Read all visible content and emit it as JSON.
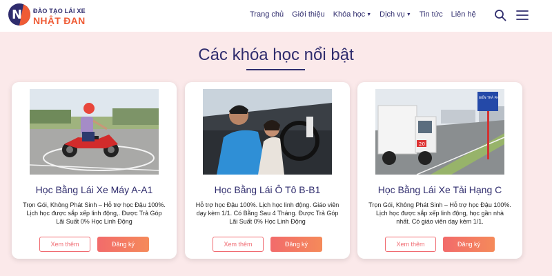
{
  "logo": {
    "top_text": "ĐÀO TẠO LÁI XE",
    "bottom_text": "NHẬT ĐAN",
    "mark": "N"
  },
  "nav": [
    {
      "label": "Trang chủ",
      "has_dropdown": false
    },
    {
      "label": "Giới thiệu",
      "has_dropdown": false
    },
    {
      "label": "Khóa học",
      "has_dropdown": true
    },
    {
      "label": "Dịch vụ",
      "has_dropdown": true
    },
    {
      "label": "Tin tức",
      "has_dropdown": false
    },
    {
      "label": "Liên hệ",
      "has_dropdown": false
    }
  ],
  "icons": {
    "search": "search-icon",
    "menu": "hamburger-menu-icon"
  },
  "section": {
    "title": "Các khóa học nổi bật"
  },
  "colors": {
    "primary": "#2f2c6d",
    "accent": "#ef5b35",
    "button": "#f26b6b",
    "background": "#fbe9ea"
  },
  "cards": [
    {
      "title": "Học Bằng Lái Xe Máy A-A1",
      "desc_lines": [
        "Trọn Gói, Không Phát Sinh – Hỗ trợ học Đậu 100%.",
        "Lịch học được sắp xếp linh động,. Được Trả Góp",
        "Lãi Suất 0% Học Linh Động"
      ],
      "more_label": "Xem thêm",
      "register_label": "Đăng ký"
    },
    {
      "title": "Học Bằng Lái Ô Tô B-B1",
      "desc_lines": [
        "Hỗ trợ học Đậu 100%. Lịch học linh động. Giáo viên",
        "dạy kèm 1/1. Có Bằng Sau 4 Tháng. Được Trả Góp",
        "Lãi Suất 0% Học Linh Động"
      ],
      "more_label": "Xem thêm",
      "register_label": "Đăng ký"
    },
    {
      "title": "Học Bằng Lái Xe Tải Hạng C",
      "desc_lines": [
        "Trọn Gói, Không Phát Sinh – Hỗ trợ học Đậu 100%.",
        "Lịch học được sắp xếp linh động, học gần nhà",
        "nhất. Có giáo viên dạy kèm 1/1."
      ],
      "more_label": "Xem thêm",
      "register_label": "Đăng ký"
    }
  ],
  "images": {
    "truck_sign": "BIỂN TRẢ PHÍ",
    "truck_plate": "20"
  }
}
